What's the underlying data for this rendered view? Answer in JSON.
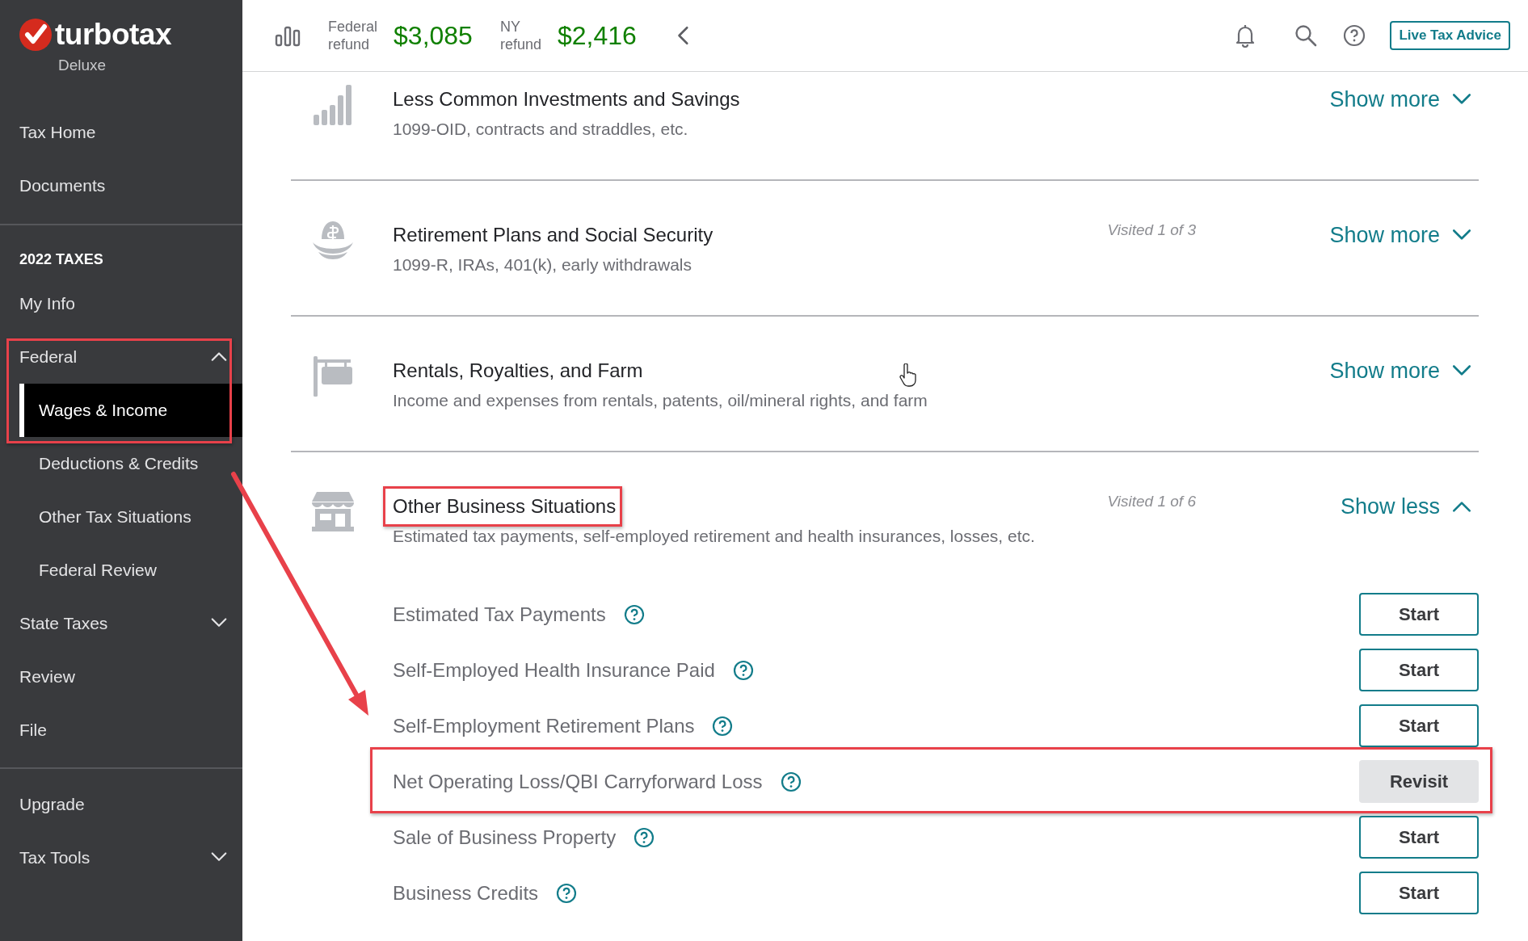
{
  "brand": {
    "name": "turbotax",
    "edition": "Deluxe"
  },
  "sidebar": {
    "sections": [
      {
        "items": [
          {
            "label": "Tax Home",
            "kind": "link"
          },
          {
            "label": "Documents",
            "kind": "link"
          }
        ]
      },
      {
        "heading": "2022 TAXES",
        "items": [
          {
            "label": "My Info",
            "kind": "link"
          },
          {
            "label": "Federal",
            "kind": "group",
            "expanded": true,
            "highlighted": true,
            "children": [
              {
                "label": "Wages & Income",
                "selected": true
              },
              {
                "label": "Deductions & Credits",
                "selected": false
              },
              {
                "label": "Other Tax Situations",
                "selected": false
              },
              {
                "label": "Federal Review",
                "selected": false
              }
            ]
          },
          {
            "label": "State Taxes",
            "kind": "group",
            "expanded": false,
            "highlighted": false
          },
          {
            "label": "Review",
            "kind": "link"
          },
          {
            "label": "File",
            "kind": "link"
          }
        ]
      },
      {
        "items": [
          {
            "label": "Upgrade",
            "kind": "link"
          },
          {
            "label": "Tax Tools",
            "kind": "group",
            "expanded": false,
            "highlighted": false
          }
        ]
      }
    ]
  },
  "header": {
    "refunds": [
      {
        "label": "Federal refund",
        "amount": "$3,085"
      },
      {
        "label": "NY refund",
        "amount": "$2,416"
      }
    ],
    "advice_button": "Live Tax Advice"
  },
  "categories": [
    {
      "kind": "investments",
      "title": "Less Common Investments and Savings",
      "description": "1099-OID, contracts and straddles, etc.",
      "toggle": "Show more",
      "expanded": false,
      "highlighted": false
    },
    {
      "kind": "retirement",
      "title": "Retirement Plans and Social Security",
      "description": "1099-R, IRAs, 401(k), early withdrawals",
      "visited": "Visited 1 of 3",
      "toggle": "Show more",
      "expanded": false,
      "highlighted": false
    },
    {
      "kind": "rentals",
      "title": "Rentals, Royalties, and Farm",
      "description": "Income and expenses from rentals, patents, oil/mineral rights, and farm",
      "toggle": "Show more",
      "expanded": false,
      "highlighted": false
    },
    {
      "kind": "business",
      "title": "Other Business Situations",
      "description": "Estimated tax payments, self-employed retirement and health insurances, losses, etc.",
      "visited": "Visited 1 of 6",
      "toggle": "Show less",
      "expanded": true,
      "highlighted": true,
      "items": [
        {
          "label": "Estimated Tax Payments",
          "action": "Start",
          "kind": "start",
          "highlighted": false
        },
        {
          "label": "Self-Employed Health Insurance Paid",
          "action": "Start",
          "kind": "start",
          "highlighted": false
        },
        {
          "label": "Self-Employment Retirement Plans",
          "action": "Start",
          "kind": "start",
          "highlighted": false
        },
        {
          "label": "Net Operating Loss/QBI Carryforward Loss",
          "action": "Revisit",
          "kind": "revisit",
          "highlighted": true
        },
        {
          "label": "Sale of Business Property",
          "action": "Start",
          "kind": "start",
          "highlighted": false
        },
        {
          "label": "Business Credits",
          "action": "Start",
          "kind": "start",
          "highlighted": false
        }
      ]
    }
  ],
  "annotation_arrow": true
}
